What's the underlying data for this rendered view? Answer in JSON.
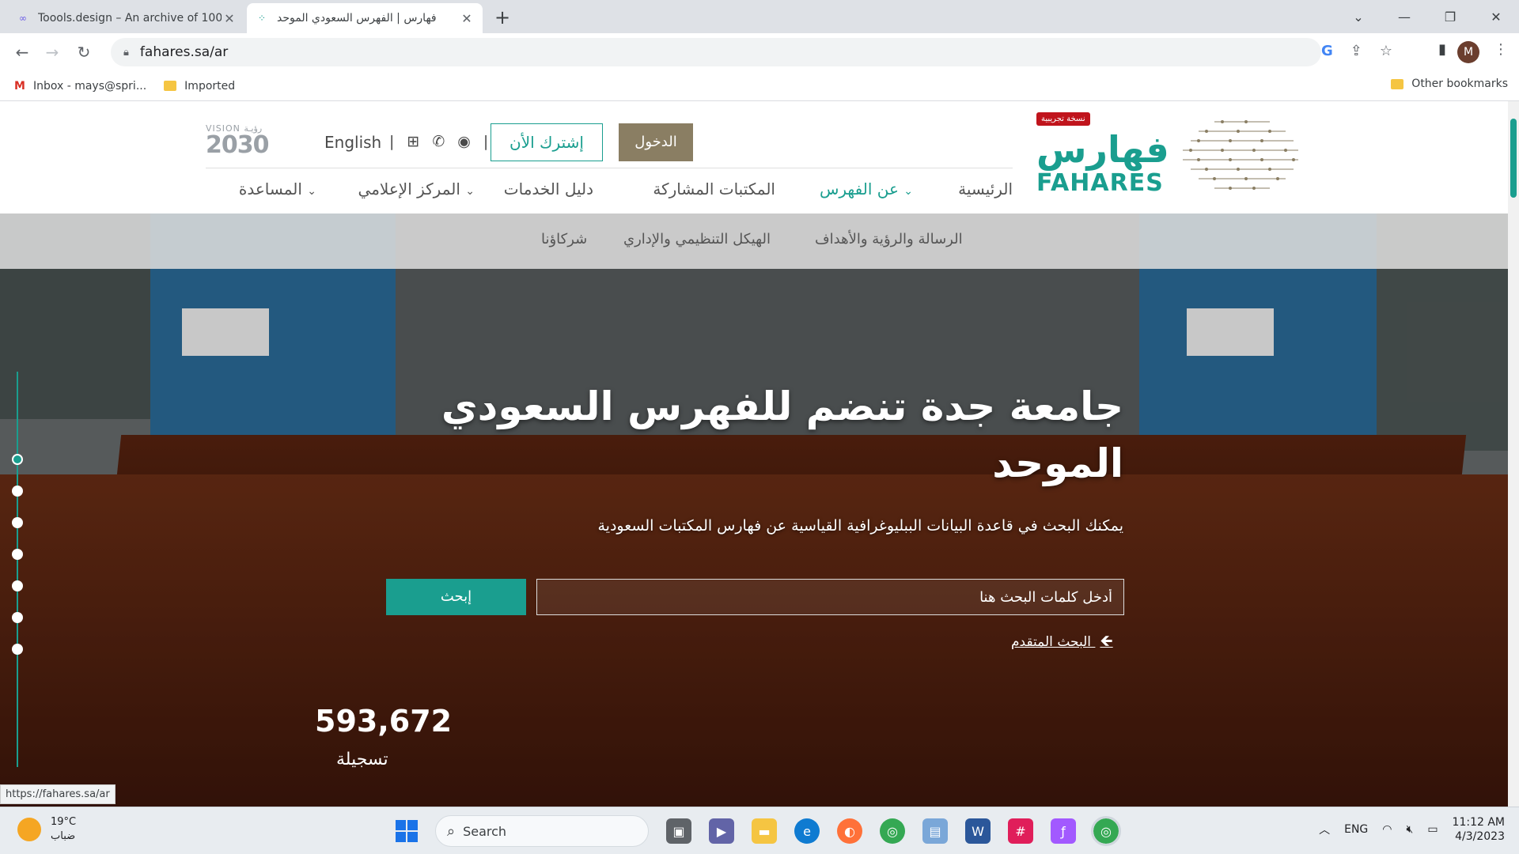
{
  "browser": {
    "tabs": [
      {
        "title": "Toools.design – An archive of 100",
        "active": false
      },
      {
        "title": "فهارس | الفهرس السعودي الموحد",
        "active": true
      }
    ],
    "url": "fahares.sa/ar",
    "bookmarks": [
      {
        "label": "Inbox - mays@spri..."
      },
      {
        "label": "Imported"
      }
    ],
    "other_bookmarks": "Other bookmarks",
    "profile_initial": "M",
    "status_url": "https://fahares.sa/ar"
  },
  "header": {
    "logo_ar": "فهارس",
    "logo_en": "FAHARES",
    "beta_badge": "نسخة تجريبية",
    "vision_small": "VISION رؤيـة",
    "vision_year": "2030",
    "language": "English",
    "subscribe": "إشترك الأن",
    "login": "الدخول"
  },
  "main_nav": [
    {
      "label": "الرئيسية",
      "active": false,
      "dropdown": false
    },
    {
      "label": "عن الفهرس",
      "active": true,
      "dropdown": true
    },
    {
      "label": "المكتبات المشاركة",
      "active": false,
      "dropdown": false
    },
    {
      "label": "دليل الخدمات",
      "active": false,
      "dropdown": false
    },
    {
      "label": "المركز الإعلامي",
      "active": false,
      "dropdown": true
    },
    {
      "label": "المساعدة",
      "active": false,
      "dropdown": true
    }
  ],
  "sub_nav": [
    {
      "label": "الرسالة والرؤية والأهداف"
    },
    {
      "label": "الهيكل التنظيمي والإداري"
    },
    {
      "label": "شركاؤنا"
    }
  ],
  "hero": {
    "title": "جامعة جدة تنضم للفهرس السعودي الموحد",
    "subtitle": "يمكنك البحث في قاعدة البيانات الببليوغرافية القياسية عن فهارس المكتبات السعودية",
    "search_placeholder": "أدخل كلمات البحث هنا",
    "search_button": "إبحث",
    "advanced_search": "البحث المتقدم",
    "stat_value": "593,672",
    "stat_label": "تسجيلة"
  },
  "taskbar": {
    "temperature": "19°C",
    "weather": "ضباب",
    "search": "Search",
    "language": "ENG",
    "time": "11:12 AM",
    "date": "4/3/2023"
  },
  "colors": {
    "brand_teal": "#1a9e8f",
    "login_bg": "#8a7e63",
    "beta_red": "#c0141c"
  }
}
